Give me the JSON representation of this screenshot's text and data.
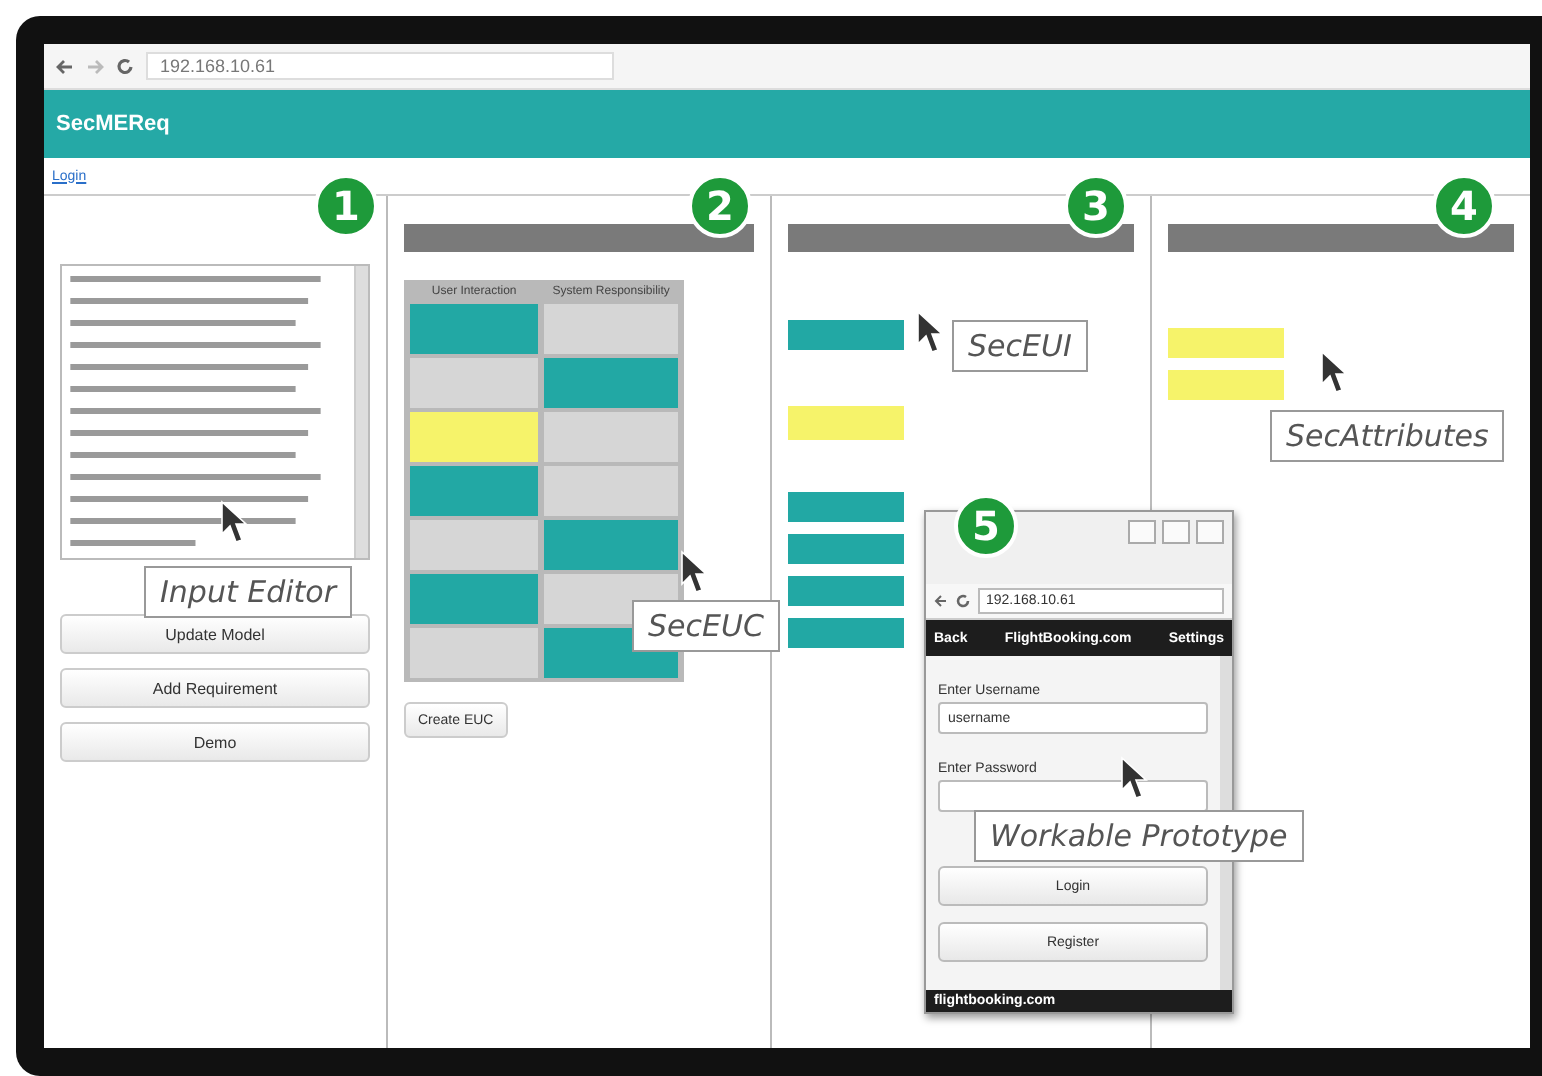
{
  "browser": {
    "address": "192.168.10.61"
  },
  "header": {
    "logo": "SecMEReq"
  },
  "login_link": "Login",
  "editor": {
    "buttons": [
      "Update Model",
      "Add Requirement",
      "Demo"
    ]
  },
  "euc": {
    "columns": [
      "User Interaction",
      "System Responsibility"
    ],
    "rows": [
      {
        "cells": [
          {
            "kind": "action"
          },
          {
            "kind": "empty"
          }
        ]
      },
      {
        "cells": [
          {
            "kind": "empty"
          },
          {
            "kind": "action"
          }
        ]
      },
      {
        "cells": [
          {
            "kind": "highlight"
          },
          {
            "kind": "empty"
          }
        ]
      },
      {
        "cells": [
          {
            "kind": "action"
          },
          {
            "kind": "empty"
          }
        ]
      },
      {
        "cells": [
          {
            "kind": "empty"
          },
          {
            "kind": "action"
          }
        ]
      },
      {
        "cells": [
          {
            "kind": "action"
          },
          {
            "kind": "empty"
          }
        ]
      },
      {
        "cells": [
          {
            "kind": "empty"
          },
          {
            "kind": "action"
          }
        ]
      }
    ],
    "button": "Create EUC"
  },
  "eui": {
    "items": [
      {
        "kind": "action"
      },
      {
        "kind": "highlight"
      },
      {
        "kind": "action"
      },
      {
        "kind": "action"
      },
      {
        "kind": "action"
      },
      {
        "kind": "action"
      }
    ]
  },
  "attributes": {
    "items": [
      {
        "kind": "highlight"
      },
      {
        "kind": "highlight"
      }
    ]
  },
  "badges": [
    "1",
    "2",
    "3",
    "4",
    "5"
  ],
  "callouts": [
    "Input Editor",
    "SecEUC",
    "SecEUI",
    "SecAttributes",
    "Workable Prototype"
  ],
  "prototype": {
    "address": "192.168.10.61",
    "nav_back": "Back",
    "nav_title": "FlightBooking.com",
    "nav_settings": "Settings",
    "username_label": "Enter Username",
    "username_value": "username",
    "password_label": "Enter Password",
    "buttons": [
      "Login",
      "Register"
    ],
    "footer": "flightbooking.com"
  }
}
